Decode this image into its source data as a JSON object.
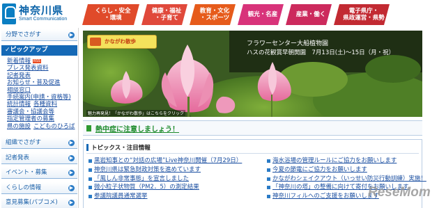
{
  "header": {
    "logo_title": "神奈川県",
    "logo_subtitle": "Smart Communication",
    "nav": [
      {
        "label": "くらし・安全\n・環境",
        "color": "#e04a2a"
      },
      {
        "label": "健康・福祉\n・子育て",
        "color": "#e0493b"
      },
      {
        "label": "教育・文化\n・スポーツ",
        "color": "#e65b1b"
      },
      {
        "label": "観光・名産",
        "color": "#d8337a"
      },
      {
        "label": "産業・働く",
        "color": "#cc2a5d"
      },
      {
        "label": "電子県庁・\n県政運営・県勢",
        "color": "#c22a32"
      }
    ]
  },
  "sidebar": {
    "bunya": "分野でさがす",
    "pickup": "ピックアップ",
    "pickup_items": [
      {
        "label": "新着情報",
        "badge": "RSS"
      },
      {
        "label": "プレス発表資料"
      },
      {
        "label": "記者発表"
      },
      {
        "label": "お知らせ・普及促進"
      },
      {
        "label": "相談窓口"
      },
      {
        "label": "手続案内(申請・資格等)"
      },
      {
        "label": "統計情報",
        "label2": "各種資料"
      },
      {
        "label": "審議会・協議会等"
      },
      {
        "label": "指定管理者の募集"
      },
      {
        "label": "県の施設",
        "label2": "こどものひろば"
      }
    ],
    "sections": [
      "組織でさがす",
      "記者発表",
      "イベント・募集",
      "くらしの情報",
      "意見募集(パブコメ)"
    ]
  },
  "banner": {
    "tag": "かながわ散歩",
    "title": "フラワーセンター大船植物園",
    "subtitle": "ハスの花観賞早朝開園　7月13日(土)～15日（月・祝）",
    "caption": "魅力再発見！「かながわ散歩」はこちらをクリック"
  },
  "heat_alert": "熱中症に注意しましょう！",
  "topics": {
    "heading": "トピックス・注目情報",
    "left": [
      "黒岩知事との“対話の広場”Live神奈川開催（7月29日）",
      "神奈川県は緊急財政対策を進めています",
      "「風しん非常事態」を宣言しました",
      "微小粒子状物質（PM2．5）の測定結果",
      "参議院議員通常選挙"
    ],
    "right": [
      "海水浴場の管理ルールにご協力をお願いします",
      "今夏の節電にご協力をお願いします",
      "かながわシェイクアウト（いっせい防災行動訓練）実施！",
      "「神奈川の塔」の整備に向けて寄付をお願いします",
      "神奈川フィルへのご支援をお願いします"
    ]
  },
  "watermark": "ReseMom"
}
